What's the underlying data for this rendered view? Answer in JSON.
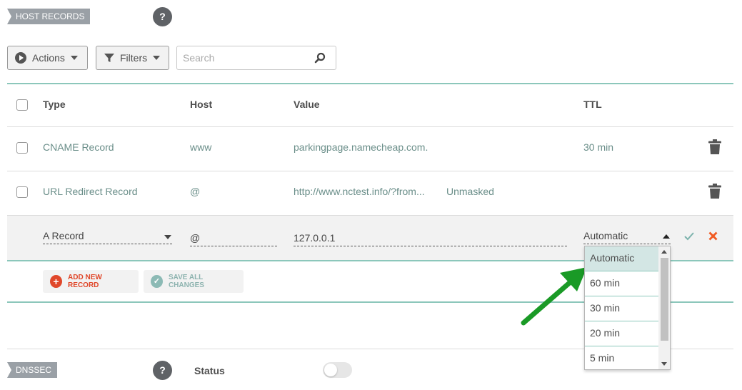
{
  "host_records": {
    "section_label": "HOST RECORDS",
    "help_label": "?",
    "toolbar": {
      "actions_label": "Actions",
      "filters_label": "Filters",
      "search_placeholder": "Search"
    },
    "columns": {
      "type": "Type",
      "host": "Host",
      "value": "Value",
      "ttl": "TTL"
    },
    "rows": [
      {
        "type": "CNAME Record",
        "host": "www",
        "value": "parkingpage.namecheap.com.",
        "extra": "",
        "ttl": "30 min"
      },
      {
        "type": "URL Redirect Record",
        "host": "@",
        "value": "http://www.nctest.info/?from...",
        "extra": "Unmasked",
        "ttl": ""
      }
    ],
    "edit_row": {
      "type": "A Record",
      "host": "@",
      "value": "127.0.0.1",
      "ttl": "Automatic",
      "ttl_options": [
        "Automatic",
        "60 min",
        "30 min",
        "20 min",
        "5 min"
      ]
    },
    "add_record_label": "ADD NEW RECORD",
    "save_changes_label": "SAVE ALL CHANGES"
  },
  "dnssec": {
    "section_label": "DNSSEC",
    "help_label": "?",
    "status_label": "Status",
    "status_enabled": false
  },
  "colors": {
    "accent_teal": "#8cc7bb",
    "danger_red": "#e0472a",
    "orange_x": "#f15a22",
    "arrow_green": "#1a9a26"
  }
}
